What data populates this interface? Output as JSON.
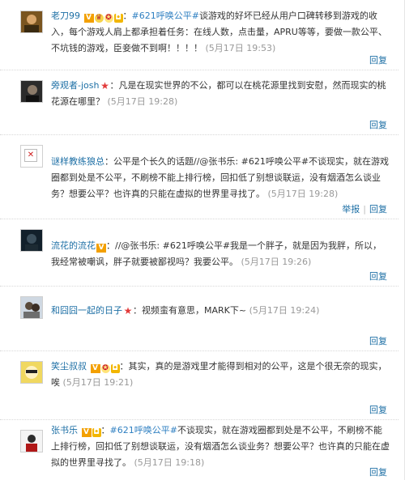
{
  "comments": [
    {
      "user": "老刀99",
      "badges": [
        "v-badge",
        "crown-badge",
        "medal-badge",
        "camera-badge"
      ],
      "topic": "#621呼唤公平#",
      "text": "谈游戏的好坏已经从用户口碑转移到游戏的收入，每个游戏人肩上都承担着任务：在线人数，点击量，APRU等等，要做一款公平、不坑钱的游戏，臣妾做不到啊！！！！",
      "time": "(5月17日 19:53)",
      "reply": "回复"
    },
    {
      "user": "旁观者-josh",
      "badges": [
        "star-badge"
      ],
      "topic": "",
      "text": "：凡是在现实世界的不公，都可以在桃花源里找到安慰，然而现实的桃花源在哪里？",
      "time": "(5月17日 19:28)",
      "reply": "回复"
    },
    {
      "user": "谜样教练狼总",
      "badges": [],
      "topic": "",
      "text": "：公平是个长久的话题//@张书乐: #621呼唤公平#不谈现实，就在游戏圈都到处是不公平，不刷榜不能上排行榜，回扣低了别想谈联运，没有烟酒怎么谈业务？想要公平？也许真的只能在虚拟的世界里寻找了。",
      "time": "(5月17日 19:28)",
      "report": "举报",
      "reply": "回复"
    },
    {
      "user": "流花的流花",
      "badges": [
        "v-badge"
      ],
      "topic": "",
      "text": "：//@张书乐: #621呼唤公平#我是一个胖子，就是因为我胖，所以，我经常被嘲讽，胖子就要被鄙视吗？我要公平。",
      "time": "(5月17日 19:26)",
      "reply": "回复"
    },
    {
      "user": "和囧囧一起的日子",
      "badges": [
        "star-badge"
      ],
      "topic": "",
      "text": "：视频蛮有意思，MARK下~",
      "time": "(5月17日 19:24)",
      "reply": "回复"
    },
    {
      "user": "笑尘叔叔",
      "badges": [
        "v-badge",
        "medal-badge",
        "camera-badge"
      ],
      "topic": "",
      "text": "：其实，真的是游戏里才能得到相对的公平，这是个很无奈的现实，唉",
      "time": "(5月17日 19:21)",
      "reply": "回复"
    },
    {
      "user": "张书乐",
      "badges": [
        "v-badge",
        "camera-badge"
      ],
      "topic": "#621呼唤公平#",
      "text": "不谈现实，就在游戏圈都到处是不公平，不刷榜不能上排行榜，回扣低了别想谈联运，没有烟酒怎么谈业务？想要公平？也许真的只能在虚拟的世界里寻找了。",
      "time": "(5月17日 19:18)",
      "reply": "回复"
    }
  ]
}
